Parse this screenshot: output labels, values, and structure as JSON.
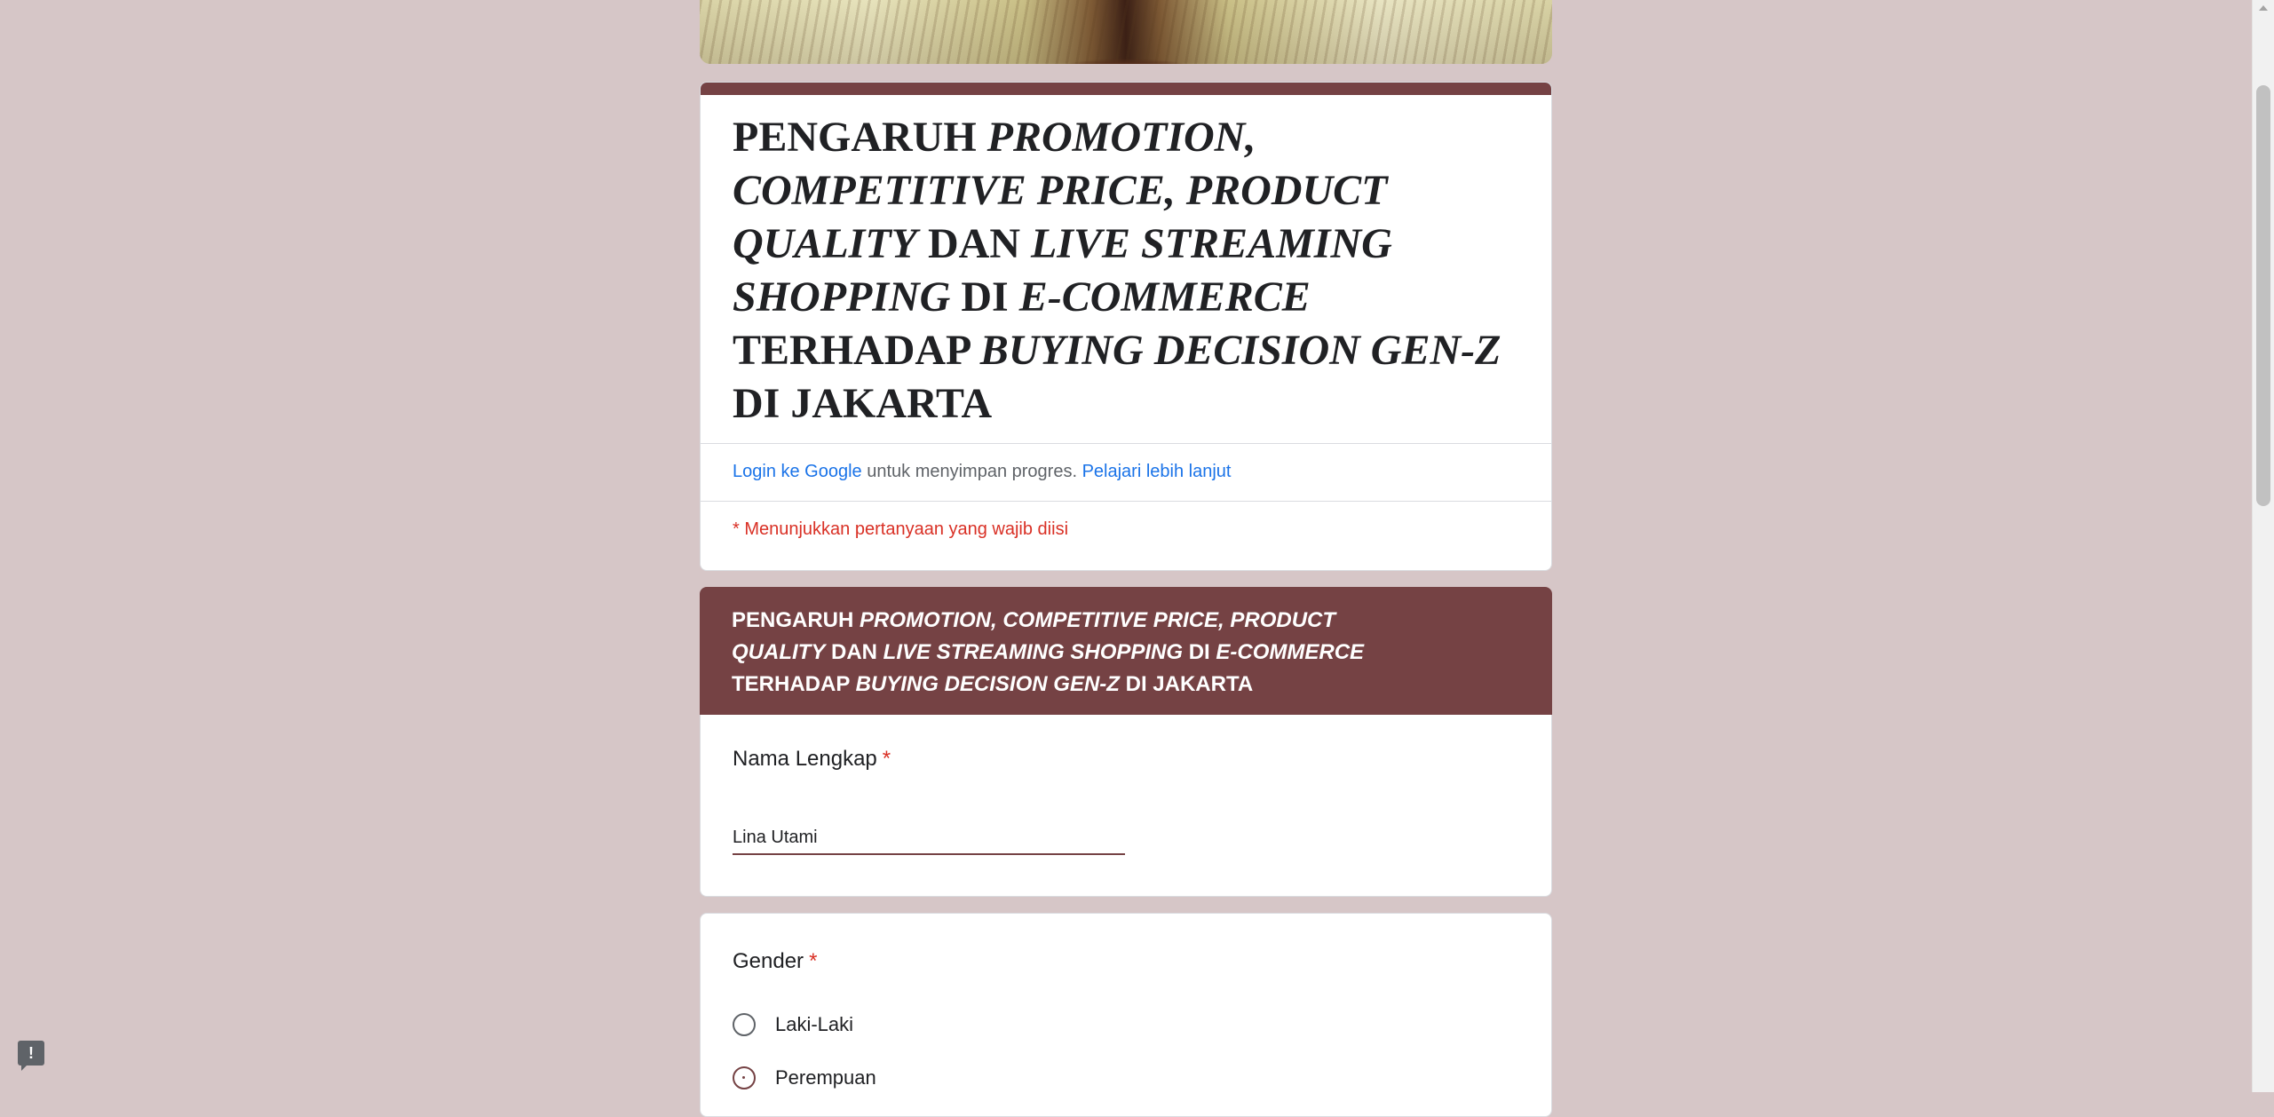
{
  "form": {
    "title_parts": [
      {
        "text": "PENGARUH ",
        "italic": false
      },
      {
        "text": "PROMOTION, COMPETITIVE PRICE, PRODUCT QUALITY",
        "italic": true
      },
      {
        "text": " DAN ",
        "italic": false
      },
      {
        "text": "LIVE STREAMING SHOPPING",
        "italic": true
      },
      {
        "text": " DI ",
        "italic": false
      },
      {
        "text": "E-COMMERCE",
        "italic": true
      },
      {
        "text": " TERHADAP ",
        "italic": false
      },
      {
        "text": "BUYING DECISION GEN-Z",
        "italic": true
      },
      {
        "text": " DI JAKARTA",
        "italic": false
      }
    ],
    "login": {
      "login_link": "Login ke Google",
      "middle_text": " untuk menyimpan progres. ",
      "learn_more_link": "Pelajari lebih lanjut"
    },
    "required_note": "* Menunjukkan pertanyaan yang wajib diisi"
  },
  "section": {
    "title_parts": [
      {
        "text": "PENGARUH ",
        "italic": false
      },
      {
        "text": "PROMOTION, COMPETITIVE PRICE, PRODUCT QUALITY",
        "italic": true
      },
      {
        "text": " DAN ",
        "italic": false
      },
      {
        "text": "LIVE STREAMING SHOPPING",
        "italic": true
      },
      {
        "text": " DI ",
        "italic": false
      },
      {
        "text": "E-COMMERCE",
        "italic": true
      },
      {
        "text": " TERHADAP ",
        "italic": false
      },
      {
        "text": "BUYING DECISION GEN-Z",
        "italic": true
      },
      {
        "text": " DI JAKARTA",
        "italic": false
      }
    ]
  },
  "questions": {
    "name": {
      "label": "Nama Lengkap",
      "required_mark": "*",
      "value": "Lina Utami"
    },
    "gender": {
      "label": "Gender",
      "required_mark": "*",
      "options": [
        {
          "label": "Laki-Laki",
          "selected": false
        },
        {
          "label": "Perempuan",
          "selected": true
        }
      ]
    }
  },
  "feedback": {
    "icon": "feedback-icon",
    "glyph": "!"
  },
  "colors": {
    "background": "#d6c6c7",
    "theme": "#754244",
    "link": "#1a73e8",
    "required": "#d93025"
  }
}
